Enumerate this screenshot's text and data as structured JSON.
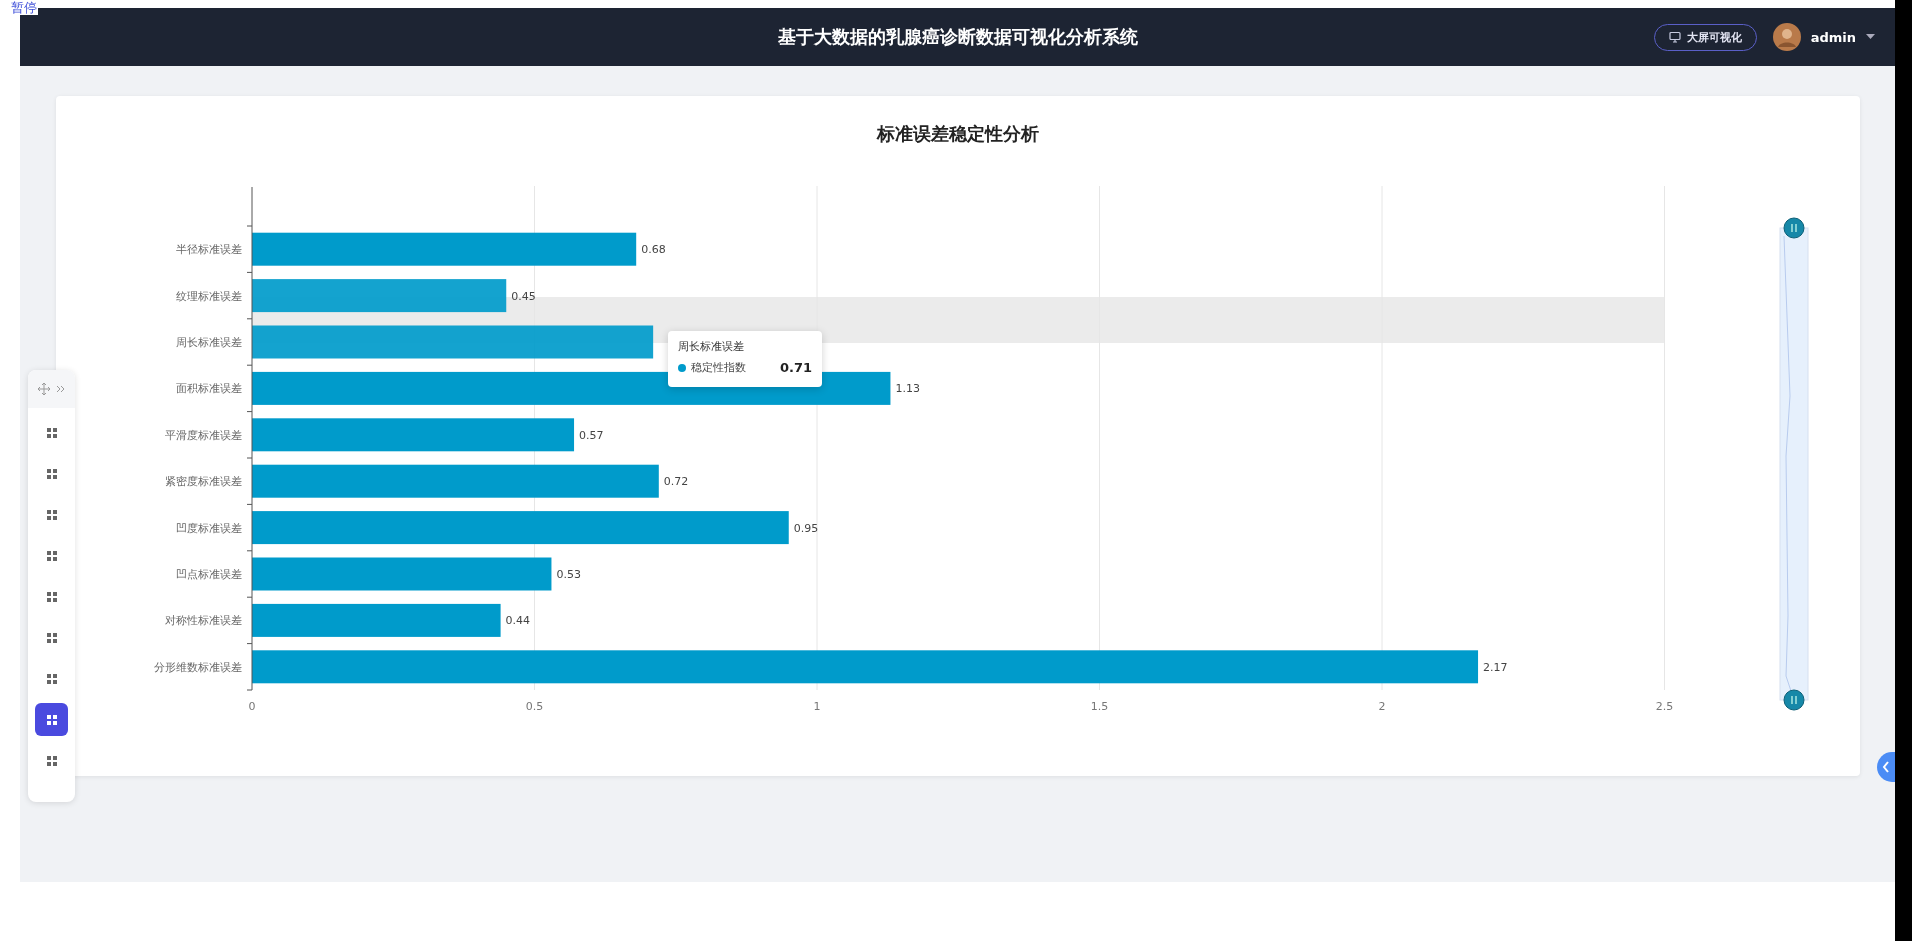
{
  "overlay_label": "暂停",
  "header": {
    "title": "基于大数据的乳腺癌诊断数据可视化分析系统",
    "screen_button": "大屏可视化",
    "user": "admin"
  },
  "float_toolbar": {
    "items": [
      {
        "selected": false
      },
      {
        "selected": false
      },
      {
        "selected": false
      },
      {
        "selected": false
      },
      {
        "selected": false
      },
      {
        "selected": false
      },
      {
        "selected": false
      },
      {
        "selected": true
      },
      {
        "selected": false
      }
    ]
  },
  "chart_card": {
    "chart_data": {
      "type": "bar",
      "orientation": "horizontal",
      "title": "标准误差稳定性分析",
      "categories": [
        "半径标准误差",
        "纹理标准误差",
        "周长标准误差",
        "面积标准误差",
        "平滑度标准误差",
        "紧密度标准误差",
        "凹度标准误差",
        "凹点标准误差",
        "对称性标准误差",
        "分形维数标准误差"
      ],
      "series": [
        {
          "name": "稳定性指数",
          "color": "#009bcb",
          "values": [
            0.68,
            0.45,
            0.71,
            1.13,
            0.57,
            0.72,
            0.95,
            0.53,
            0.44,
            2.17
          ]
        }
      ],
      "value_labels": [
        "0.68",
        "0.45",
        null,
        "1.13",
        "0.57",
        "0.72",
        "0.95",
        "0.53",
        "0.44",
        "2.17"
      ],
      "xlim": [
        0,
        2.5
      ],
      "grid": true,
      "xticks": [
        0,
        0.5,
        1,
        1.5,
        2,
        2.5
      ]
    },
    "tooltip": {
      "title": "周长标准误差",
      "value": "0.71"
    }
  }
}
